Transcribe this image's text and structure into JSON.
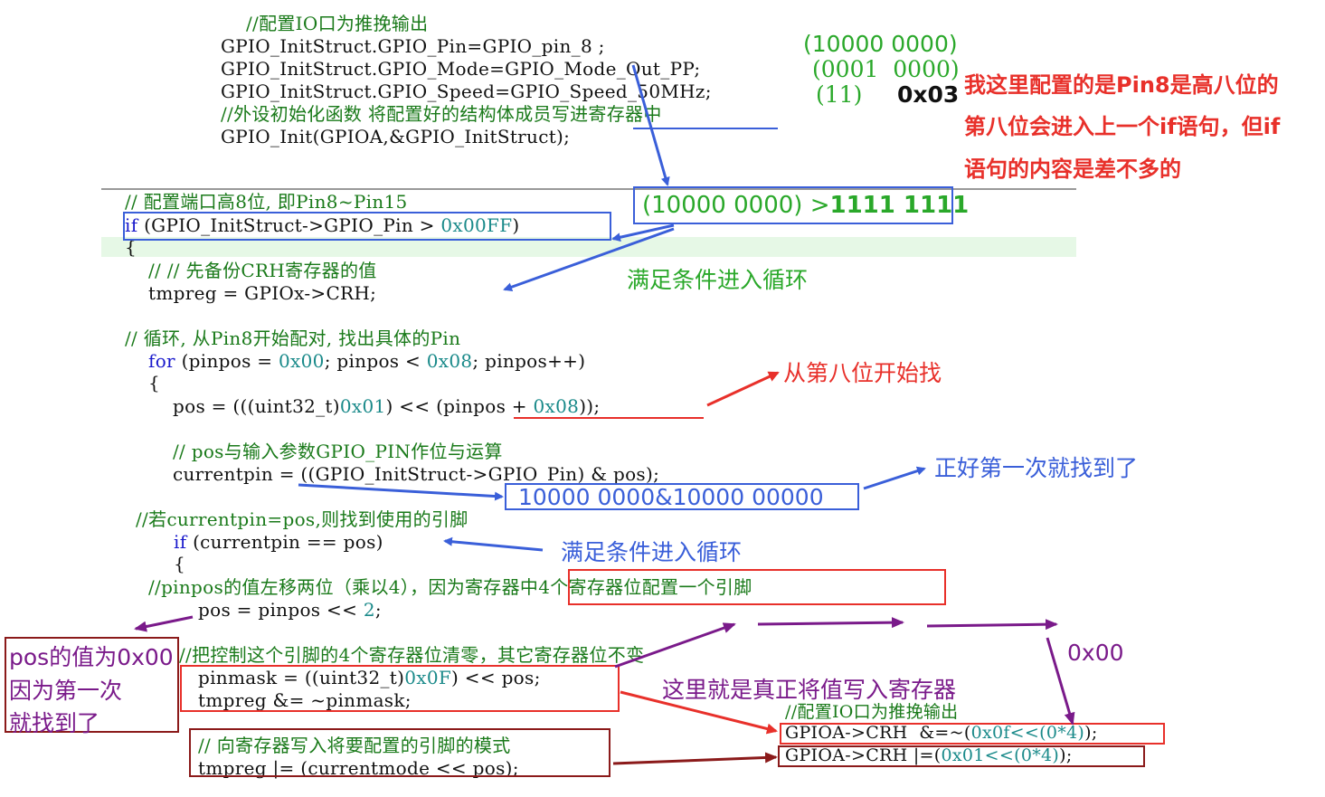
{
  "top_code": {
    "c1": "//配置IO口为推挽输出",
    "l1": "GPIO_InitStruct.GPIO_Pin=GPIO_pin_8 ;",
    "l2": "GPIO_InitStruct.GPIO_Mode=GPIO_Mode_Out_PP;",
    "l3": "GPIO_InitStruct.GPIO_Speed=GPIO_Speed_50MHz;",
    "c2": "//外设初始化函数 将配置好的结构体成员写进寄存器中",
    "l4": "GPIO_Init(GPIOA,&GPIO_InitStruct);"
  },
  "top_notes": {
    "bin1": "(10000 0000)",
    "bin2": "(0001  0000)",
    "bin3": "(11)",
    "hex": "0x03",
    "red_note_1": "我这里配置的是Pin8是高八位的",
    "red_note_2": "第八位会进入上一个if语句，但if",
    "red_note_3": "语句的内容是差不多的"
  },
  "main_code": {
    "c_high8": "// 配置端口高8位, 即Pin8~Pin15",
    "if_kw": "if",
    "if_rest": " (GPIO_InitStruct->GPIO_Pin > ",
    "if_num": "0x00FF",
    "if_close": ")",
    "brace1": "{",
    "c_backup": "// // 先备份CRH寄存器的值",
    "tmpreg": "tmpreg = GPIOx->CRH;",
    "c_loop": "// 循环, 从Pin8开始配对, 找出具体的Pin",
    "for_kw": "for",
    "for_a": " (pinpos = ",
    "for_n1": "0x00",
    "for_b": "; pinpos < ",
    "for_n2": "0x08",
    "for_c": "; pinpos++)",
    "brace2": "{",
    "pos_a": "pos = (((uint32_t)",
    "pos_n1": "0x01",
    "pos_b": ") << (pinpos + ",
    "pos_n2": "0x08",
    "pos_c": "));",
    "c_and": "// pos与输入参数GPIO_PIN作位与运算",
    "currentpin": "currentpin = ((GPIO_InitStruct->GPIO_Pin) & pos);",
    "c_if2": "//若currentpin=pos,则找到使用的引脚",
    "if2_kw": "if",
    "if2_rest": " (currentpin == pos)",
    "brace3": "{",
    "c_shift": "//pinpos的值左移两位（乘以4），因为寄存器中4个寄存器位配置一个引脚",
    "pos2_a": "pos = pinpos << ",
    "pos2_n": "2",
    "pos2_b": ";",
    "c_clear": "//把控制这个引脚的4个寄存器位清零，其它寄存器位不变",
    "pinmask_a": "pinmask = ((uint32_t)",
    "pinmask_n": "0x0F",
    "pinmask_b": ") << pos;",
    "tmpreg_and": "tmpreg &= ~pinmask;",
    "c_write": "// 向寄存器写入将要配置的引脚的模式",
    "tmpreg_or": "tmpreg |= (currentmode << pos);"
  },
  "annotations": {
    "compare": "(10000 0000) >",
    "compare_ones": "1111 1111",
    "enter_loop_1": "满足条件进入循环",
    "start_eighth": "从第八位开始找",
    "found_first": "正好第一次就找到了",
    "and_result": "10000 0000&10000 00000",
    "enter_loop_2": "满足条件进入循环",
    "pos_value_1": "pos的值为0x00",
    "pos_value_2": "因为第一次",
    "pos_value_3": "就找到了",
    "hex_00": "0x00",
    "write_reg": "这里就是真正将值写入寄存器"
  },
  "right_code": {
    "c": "//配置IO口为推挽输出",
    "l1_a": "GPIOA->CRH  &=~(",
    "l1_b": "0x0f<<(0*4)",
    "l1_c": ");",
    "l2_a": "GPIOA->CRH |=(",
    "l2_b": "0x01<<(0*4)",
    "l2_c": ");"
  },
  "colors": {
    "comment": "#1a7a1a",
    "keyword": "#1a1acc",
    "number": "#1a8a8a",
    "blue_annotation": "#3a5fd9",
    "red_annotation": "#e8302a",
    "purple_annotation": "#7a1a8a",
    "dark_red": "#8b1a1a",
    "green_annotation": "#2aa82a",
    "highlight_line": "#e6f8e6"
  }
}
